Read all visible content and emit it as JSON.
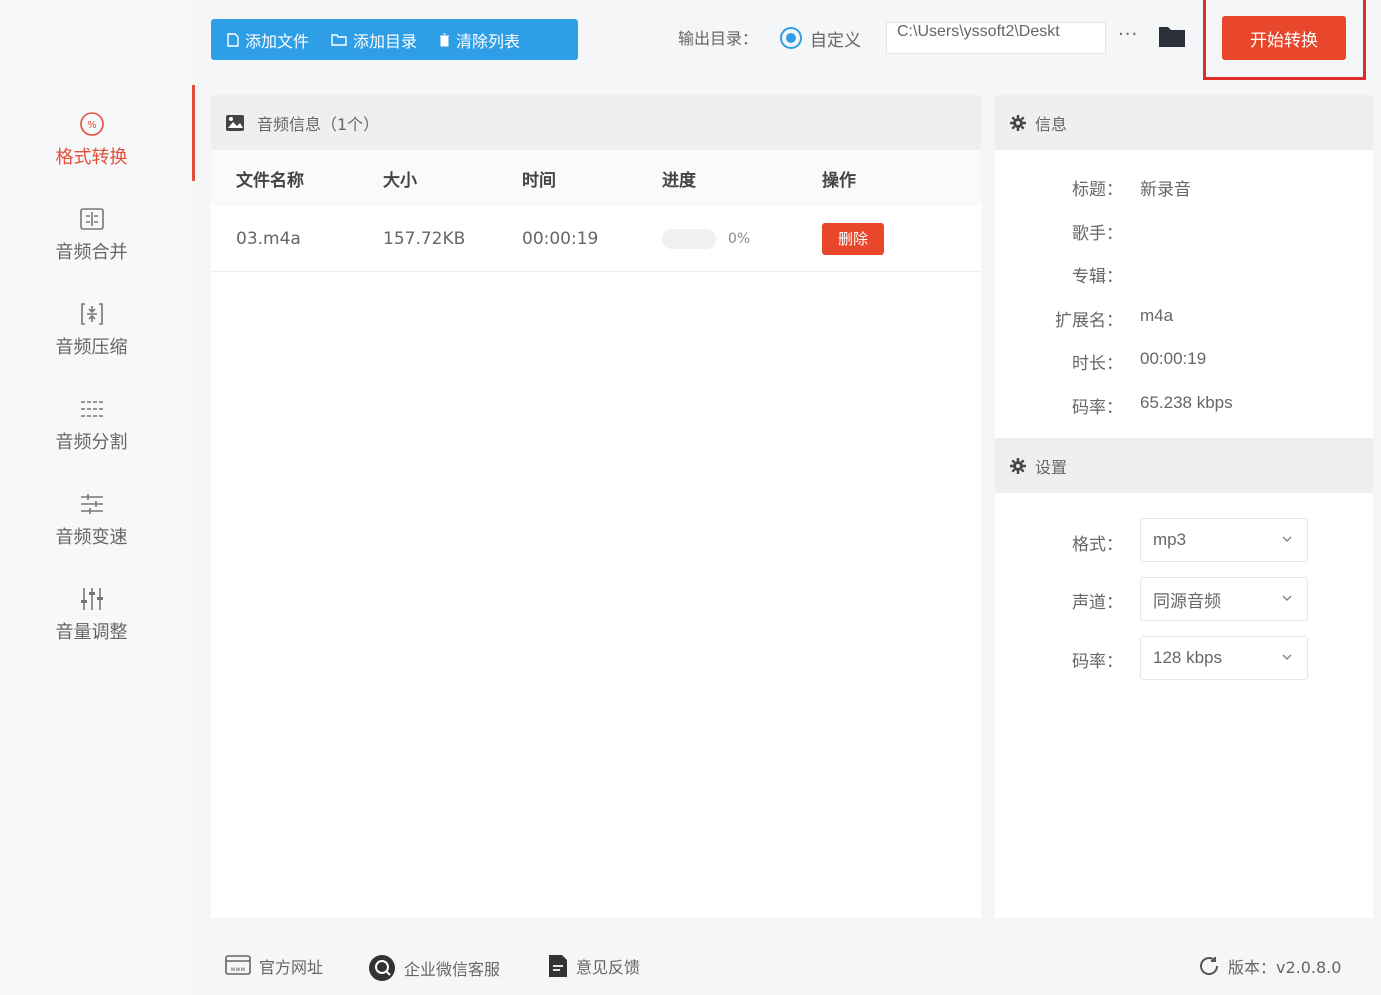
{
  "toolbar": {
    "add_file": "添加文件",
    "add_folder": "添加目录",
    "clear_list": "清除列表",
    "output_label": "输出目录：",
    "output_option": "自定义",
    "output_path": "C:\\Users\\yssoft2\\Deskt",
    "more": "···",
    "start": "开始转换"
  },
  "sidebar": {
    "items": [
      {
        "label": "格式转换",
        "icon": "format-convert-icon",
        "active": true
      },
      {
        "label": "音频合并",
        "icon": "audio-merge-icon"
      },
      {
        "label": "音频压缩",
        "icon": "audio-compress-icon"
      },
      {
        "label": "音频分割",
        "icon": "audio-split-icon"
      },
      {
        "label": "音频变速",
        "icon": "audio-speed-icon"
      },
      {
        "label": "音量调整",
        "icon": "volume-adjust-icon"
      }
    ]
  },
  "main": {
    "header": "音频信息（1个）",
    "columns": [
      "文件名称",
      "大小",
      "时间",
      "进度",
      "操作"
    ],
    "rows": [
      {
        "name": "03.m4a",
        "size": "157.72KB",
        "time": "00:00:19",
        "progress": 0,
        "progress_text": "0%",
        "action": "删除"
      }
    ]
  },
  "info": {
    "header": "信息",
    "fields": [
      {
        "label": "标题：",
        "value": "新录音"
      },
      {
        "label": "歌手：",
        "value": ""
      },
      {
        "label": "专辑：",
        "value": ""
      },
      {
        "label": "扩展名：",
        "value": "m4a"
      },
      {
        "label": "时长：",
        "value": "00:00:19"
      },
      {
        "label": "码率：",
        "value": "65.238 kbps"
      }
    ]
  },
  "settings": {
    "header": "设置",
    "fields": [
      {
        "label": "格式：",
        "value": "mp3"
      },
      {
        "label": "声道：",
        "value": "同源音频"
      },
      {
        "label": "码率：",
        "value": "128 kbps"
      }
    ]
  },
  "footer": {
    "website": "官方网址",
    "wechat": "企业微信客服",
    "feedback": "意见反馈",
    "version": "版本：v2.0.8.0"
  },
  "colors": {
    "accent": "#2e9ee6",
    "danger": "#e8472c",
    "highlight": "#e02b2b"
  }
}
